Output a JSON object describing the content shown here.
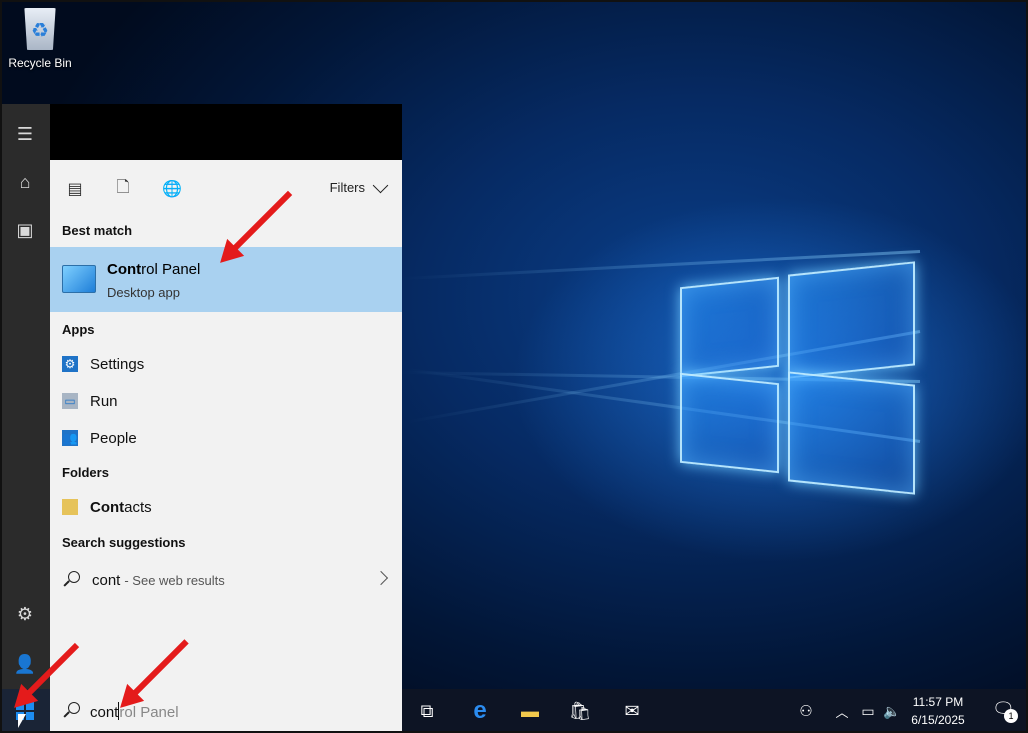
{
  "desktop": {
    "icons": [
      {
        "label": "Recycle Bin",
        "icon": "recycle-bin-icon"
      }
    ]
  },
  "start_menu": {
    "rail_icons": [
      "hamburger-menu-icon",
      "home-icon",
      "recent-documents-icon",
      "settings-gear-icon",
      "user-icon"
    ],
    "toolbar": {
      "scope_icons": [
        "apps-scope-icon",
        "documents-scope-icon",
        "web-scope-icon"
      ],
      "filters_label": "Filters"
    },
    "best_match": {
      "heading": "Best match",
      "title_bold": "Cont",
      "title_rest": "rol Panel",
      "subtitle": "Desktop app",
      "icon": "control-panel-icon"
    },
    "apps": {
      "heading": "Apps",
      "items": [
        {
          "label": "Settings",
          "icon": "settings-gear-icon"
        },
        {
          "label": "Run",
          "icon": "run-icon"
        },
        {
          "label": "People",
          "icon": "people-icon"
        }
      ]
    },
    "folders": {
      "heading": "Folders",
      "items": [
        {
          "label_bold": "Cont",
          "label_rest": "acts",
          "icon": "folder-icon"
        }
      ]
    },
    "search_suggestions": {
      "heading": "Search suggestions",
      "query": "cont",
      "suffix": "- See web results"
    }
  },
  "taskbar": {
    "search_typed": "cont",
    "search_ghost": "rol Panel",
    "pinned": [
      "task-view-icon",
      "edge-icon",
      "file-explorer-icon",
      "store-icon",
      "mail-icon"
    ],
    "tray": [
      "people-icon",
      "show-hidden-icons-icon",
      "network-icon",
      "volume-icon"
    ],
    "clock_time": "11:57 PM",
    "clock_date": "6/15/2025",
    "notification_count": "1"
  },
  "colors": {
    "highlight": "#a9d1f0",
    "accent": "#1f73c7",
    "annotation_arrow": "#e41b1b"
  }
}
